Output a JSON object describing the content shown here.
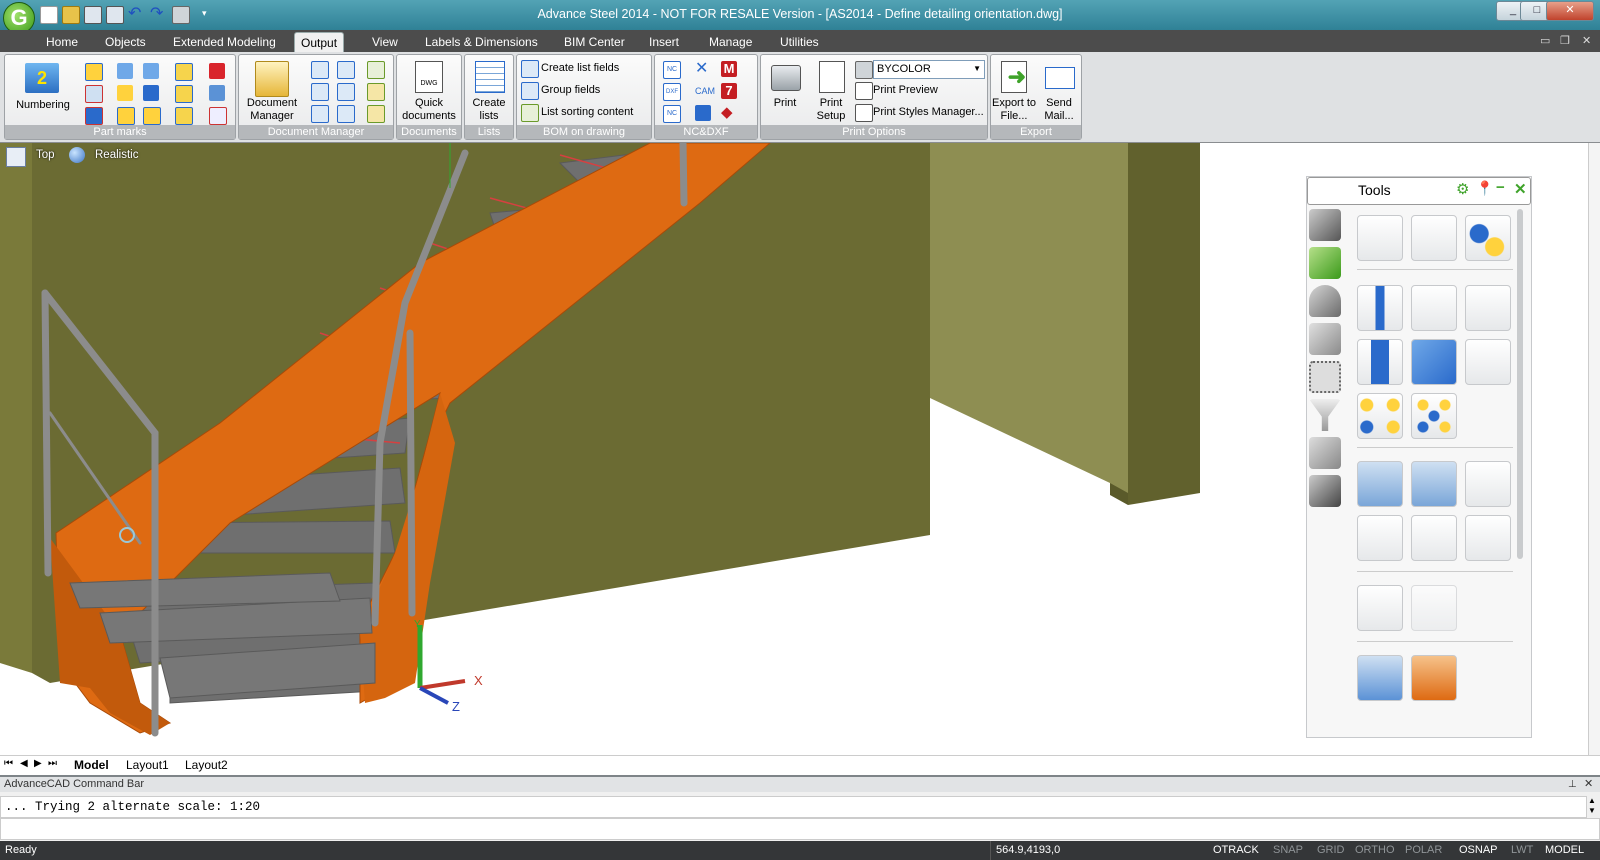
{
  "window": {
    "title": "Advance Steel 2014 - NOT FOR RESALE Version - [AS2014 - Define detailing orientation.dwg]",
    "logo": "G",
    "qat_icons": [
      "new-icon",
      "open-icon",
      "save-icon",
      "save-as-icon",
      "undo-icon",
      "redo-icon",
      "print-icon",
      "customize-icon"
    ],
    "buttons": {
      "minimize": "_",
      "maximize": "□",
      "close": "✕"
    }
  },
  "menu": {
    "tabs": [
      "Home",
      "Objects",
      "Extended Modeling",
      "Output",
      "View",
      "Labels & Dimensions",
      "BIM Center",
      "Insert",
      "Manage",
      "Utilities"
    ],
    "active": "Output"
  },
  "ribbon": {
    "part_marks": {
      "numbering": "Numbering",
      "label": "Part marks"
    },
    "document_manager": {
      "button": "Document Manager",
      "label": "Document Manager"
    },
    "documents": {
      "button": "Quick documents",
      "label": "Documents"
    },
    "lists": {
      "button": "Create lists",
      "label": "Lists"
    },
    "bom": {
      "items": [
        "Create list fields",
        "Group fields",
        "List sorting content"
      ],
      "label": "BOM on drawing"
    },
    "ncdxf": {
      "label": "NC&DXF",
      "icons": [
        "NC",
        "DXF",
        "NC"
      ]
    },
    "print": {
      "print": "Print",
      "print_setup": "Print Setup",
      "color_select": "BYCOLOR",
      "preview": "Print Preview",
      "styles": "Print Styles Manager...",
      "label": "Print Options"
    },
    "export": {
      "export": "Export to File...",
      "send": "Send Mail...",
      "label": "Export"
    }
  },
  "viewport": {
    "view_name": "Top",
    "visual_style": "Realistic",
    "axis_x": "X",
    "axis_z": "Z",
    "axis_y": "Y",
    "colors": {
      "stringer": "#de6a12",
      "tread": "#6f6f6f",
      "wall": "#6b6b33",
      "rail": "#8c8c8c"
    }
  },
  "tools_palette": {
    "title": "Tools",
    "side_icons": [
      "pencil-icon",
      "wrench-icon",
      "user-icon",
      "ucs-axes-icon",
      "selection-icon",
      "filter-icon",
      "bend-icon",
      "beam-icon"
    ]
  },
  "layouts": {
    "tabs": [
      "Model",
      "Layout1",
      "Layout2"
    ],
    "active": "Model"
  },
  "command_bar": {
    "title": "AdvanceCAD Command Bar",
    "text": "... Trying 2 alternate scale: 1:20"
  },
  "status": {
    "ready": "Ready",
    "coords": "564.9,4193,0",
    "toggles": [
      {
        "label": "OTRACK",
        "on": true
      },
      {
        "label": "SNAP",
        "on": false
      },
      {
        "label": "GRID",
        "on": false
      },
      {
        "label": "ORTHO",
        "on": false
      },
      {
        "label": "POLAR",
        "on": false
      },
      {
        "label": "OSNAP",
        "on": true
      },
      {
        "label": "LWT",
        "on": false
      },
      {
        "label": "MODEL",
        "on": true
      }
    ]
  }
}
